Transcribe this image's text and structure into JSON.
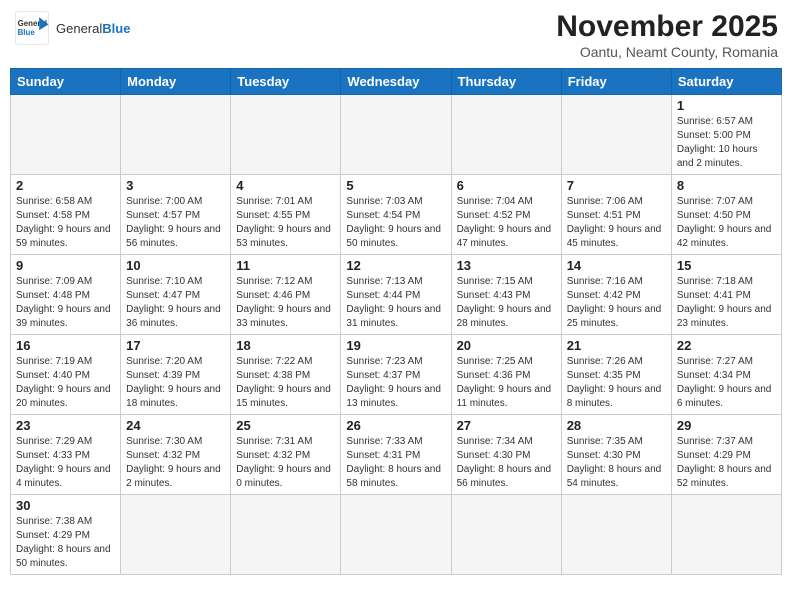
{
  "header": {
    "logo_general": "General",
    "logo_blue": "Blue",
    "month_year": "November 2025",
    "location": "Oantu, Neamt County, Romania"
  },
  "weekdays": [
    "Sunday",
    "Monday",
    "Tuesday",
    "Wednesday",
    "Thursday",
    "Friday",
    "Saturday"
  ],
  "weeks": [
    [
      {
        "day": "",
        "info": ""
      },
      {
        "day": "",
        "info": ""
      },
      {
        "day": "",
        "info": ""
      },
      {
        "day": "",
        "info": ""
      },
      {
        "day": "",
        "info": ""
      },
      {
        "day": "",
        "info": ""
      },
      {
        "day": "1",
        "info": "Sunrise: 6:57 AM\nSunset: 5:00 PM\nDaylight: 10 hours and 2 minutes."
      }
    ],
    [
      {
        "day": "2",
        "info": "Sunrise: 6:58 AM\nSunset: 4:58 PM\nDaylight: 9 hours and 59 minutes."
      },
      {
        "day": "3",
        "info": "Sunrise: 7:00 AM\nSunset: 4:57 PM\nDaylight: 9 hours and 56 minutes."
      },
      {
        "day": "4",
        "info": "Sunrise: 7:01 AM\nSunset: 4:55 PM\nDaylight: 9 hours and 53 minutes."
      },
      {
        "day": "5",
        "info": "Sunrise: 7:03 AM\nSunset: 4:54 PM\nDaylight: 9 hours and 50 minutes."
      },
      {
        "day": "6",
        "info": "Sunrise: 7:04 AM\nSunset: 4:52 PM\nDaylight: 9 hours and 47 minutes."
      },
      {
        "day": "7",
        "info": "Sunrise: 7:06 AM\nSunset: 4:51 PM\nDaylight: 9 hours and 45 minutes."
      },
      {
        "day": "8",
        "info": "Sunrise: 7:07 AM\nSunset: 4:50 PM\nDaylight: 9 hours and 42 minutes."
      }
    ],
    [
      {
        "day": "9",
        "info": "Sunrise: 7:09 AM\nSunset: 4:48 PM\nDaylight: 9 hours and 39 minutes."
      },
      {
        "day": "10",
        "info": "Sunrise: 7:10 AM\nSunset: 4:47 PM\nDaylight: 9 hours and 36 minutes."
      },
      {
        "day": "11",
        "info": "Sunrise: 7:12 AM\nSunset: 4:46 PM\nDaylight: 9 hours and 33 minutes."
      },
      {
        "day": "12",
        "info": "Sunrise: 7:13 AM\nSunset: 4:44 PM\nDaylight: 9 hours and 31 minutes."
      },
      {
        "day": "13",
        "info": "Sunrise: 7:15 AM\nSunset: 4:43 PM\nDaylight: 9 hours and 28 minutes."
      },
      {
        "day": "14",
        "info": "Sunrise: 7:16 AM\nSunset: 4:42 PM\nDaylight: 9 hours and 25 minutes."
      },
      {
        "day": "15",
        "info": "Sunrise: 7:18 AM\nSunset: 4:41 PM\nDaylight: 9 hours and 23 minutes."
      }
    ],
    [
      {
        "day": "16",
        "info": "Sunrise: 7:19 AM\nSunset: 4:40 PM\nDaylight: 9 hours and 20 minutes."
      },
      {
        "day": "17",
        "info": "Sunrise: 7:20 AM\nSunset: 4:39 PM\nDaylight: 9 hours and 18 minutes."
      },
      {
        "day": "18",
        "info": "Sunrise: 7:22 AM\nSunset: 4:38 PM\nDaylight: 9 hours and 15 minutes."
      },
      {
        "day": "19",
        "info": "Sunrise: 7:23 AM\nSunset: 4:37 PM\nDaylight: 9 hours and 13 minutes."
      },
      {
        "day": "20",
        "info": "Sunrise: 7:25 AM\nSunset: 4:36 PM\nDaylight: 9 hours and 11 minutes."
      },
      {
        "day": "21",
        "info": "Sunrise: 7:26 AM\nSunset: 4:35 PM\nDaylight: 9 hours and 8 minutes."
      },
      {
        "day": "22",
        "info": "Sunrise: 7:27 AM\nSunset: 4:34 PM\nDaylight: 9 hours and 6 minutes."
      }
    ],
    [
      {
        "day": "23",
        "info": "Sunrise: 7:29 AM\nSunset: 4:33 PM\nDaylight: 9 hours and 4 minutes."
      },
      {
        "day": "24",
        "info": "Sunrise: 7:30 AM\nSunset: 4:32 PM\nDaylight: 9 hours and 2 minutes."
      },
      {
        "day": "25",
        "info": "Sunrise: 7:31 AM\nSunset: 4:32 PM\nDaylight: 9 hours and 0 minutes."
      },
      {
        "day": "26",
        "info": "Sunrise: 7:33 AM\nSunset: 4:31 PM\nDaylight: 8 hours and 58 minutes."
      },
      {
        "day": "27",
        "info": "Sunrise: 7:34 AM\nSunset: 4:30 PM\nDaylight: 8 hours and 56 minutes."
      },
      {
        "day": "28",
        "info": "Sunrise: 7:35 AM\nSunset: 4:30 PM\nDaylight: 8 hours and 54 minutes."
      },
      {
        "day": "29",
        "info": "Sunrise: 7:37 AM\nSunset: 4:29 PM\nDaylight: 8 hours and 52 minutes."
      }
    ],
    [
      {
        "day": "30",
        "info": "Sunrise: 7:38 AM\nSunset: 4:29 PM\nDaylight: 8 hours and 50 minutes."
      },
      {
        "day": "",
        "info": ""
      },
      {
        "day": "",
        "info": ""
      },
      {
        "day": "",
        "info": ""
      },
      {
        "day": "",
        "info": ""
      },
      {
        "day": "",
        "info": ""
      },
      {
        "day": "",
        "info": ""
      }
    ]
  ]
}
